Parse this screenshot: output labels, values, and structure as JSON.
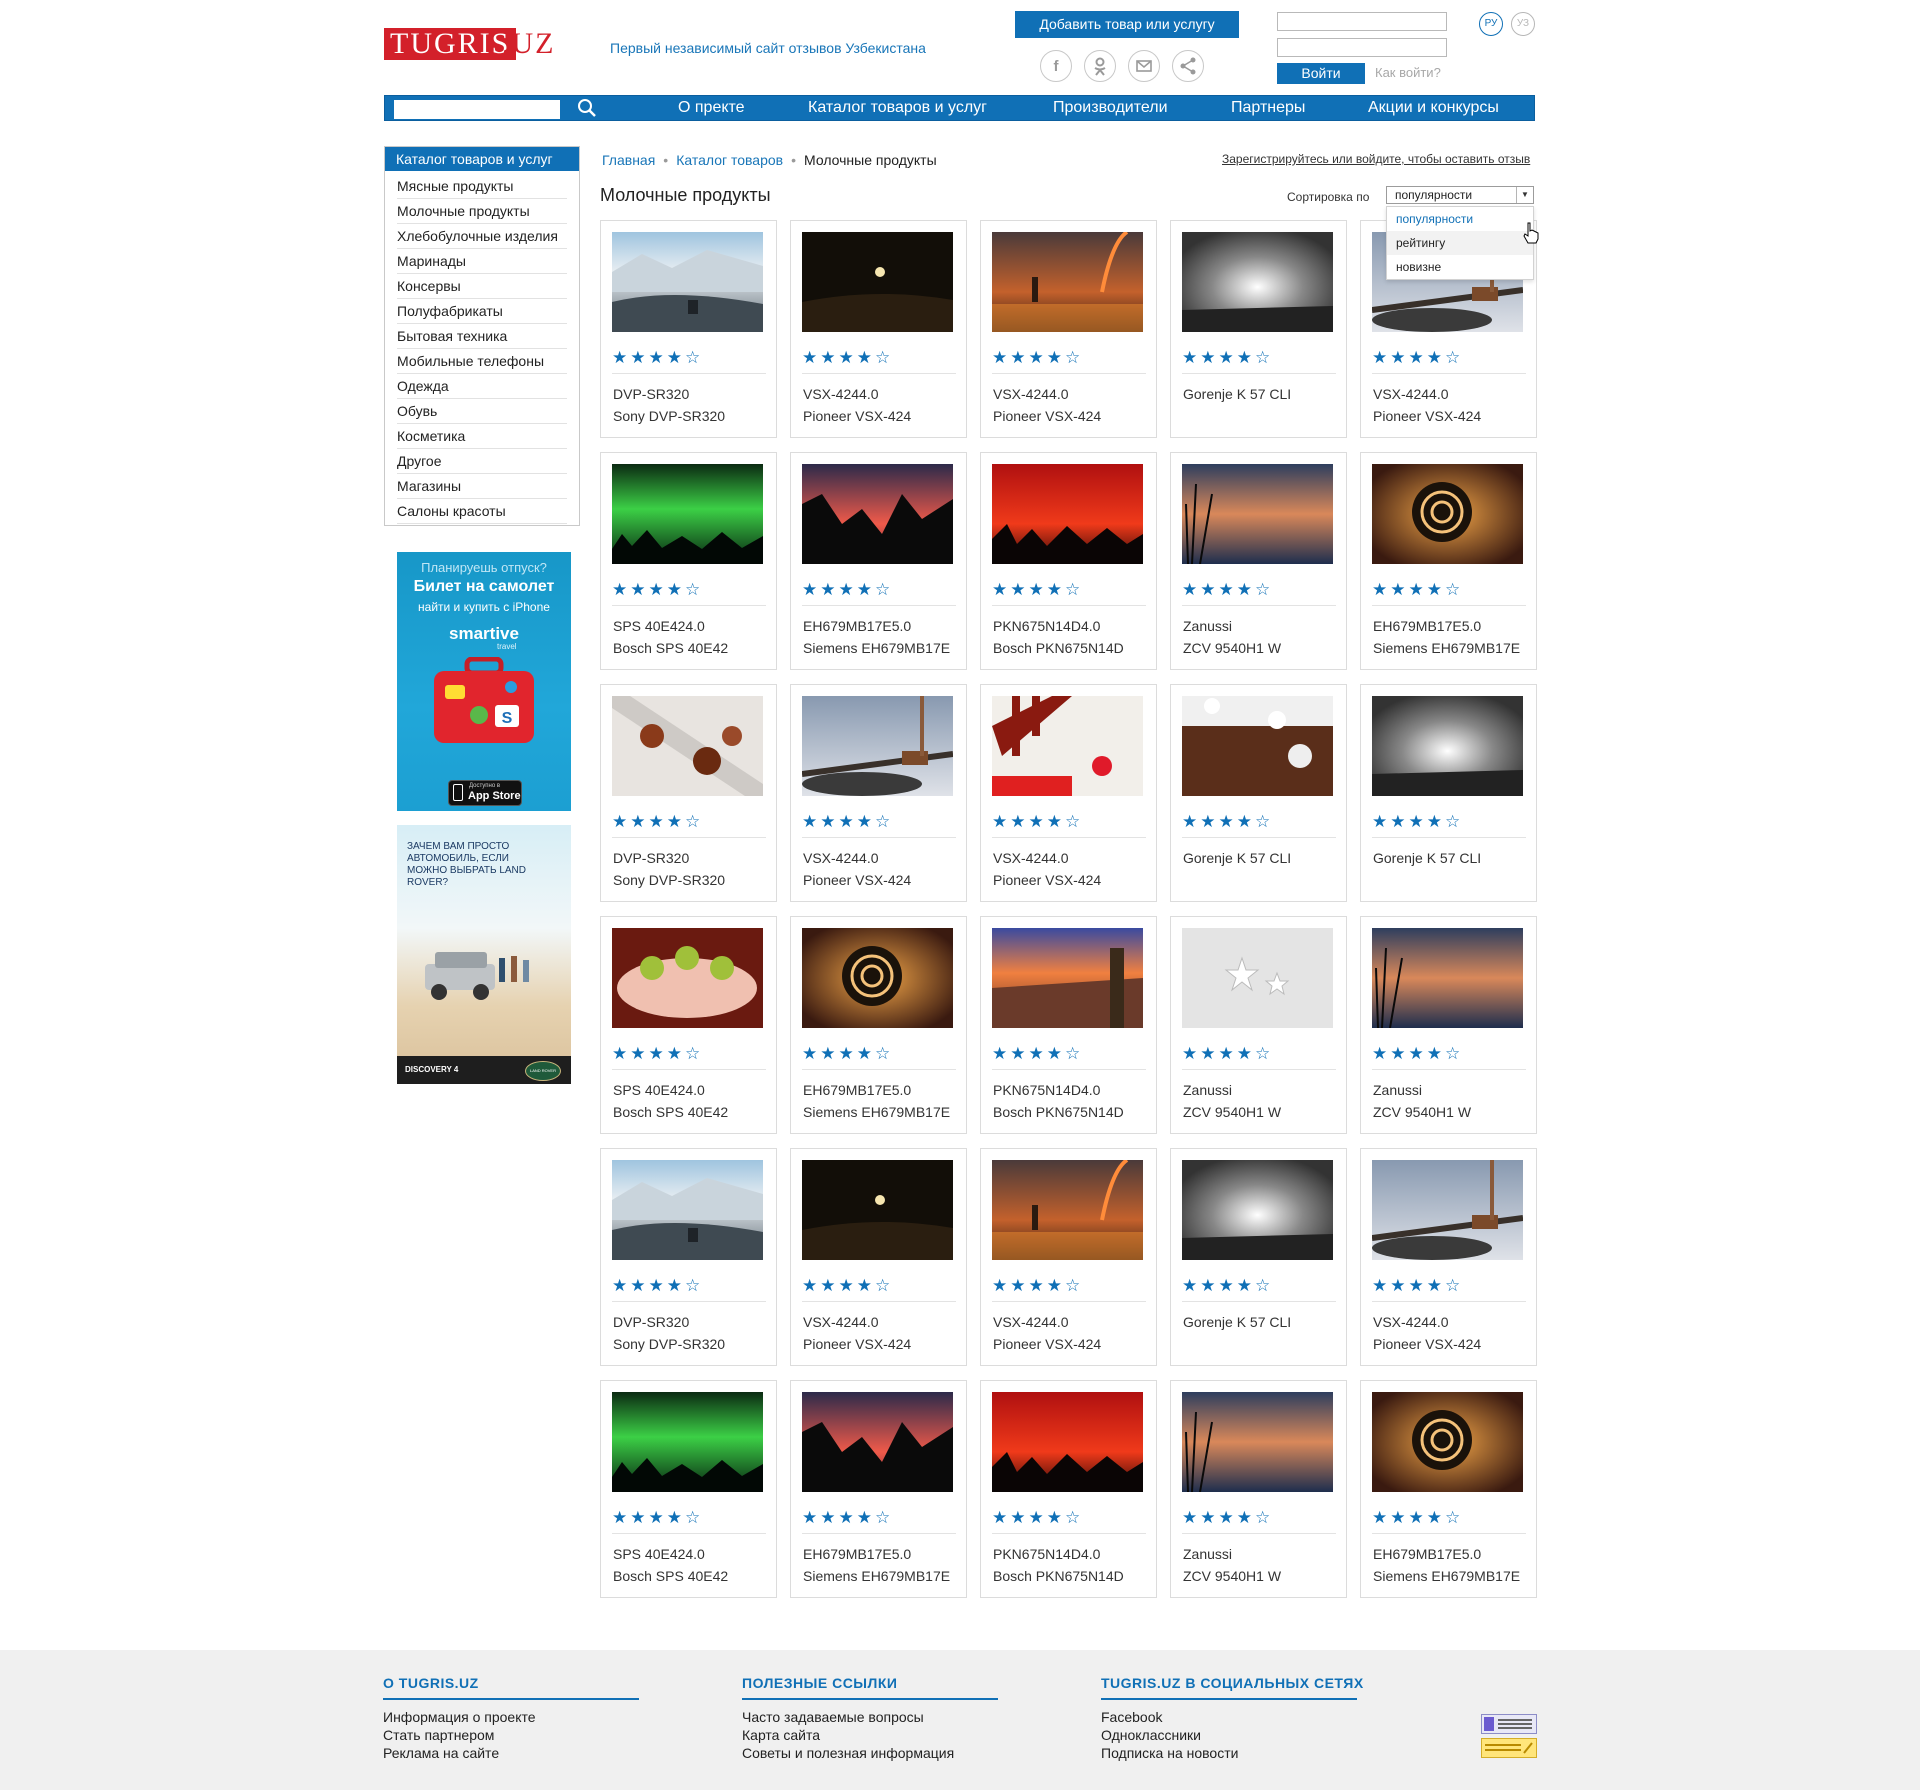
{
  "header": {
    "logo_left": "TUGRIS",
    "logo_right": ".UZ",
    "tagline": "Первый независимый сайт отзывов Узбекистана",
    "add_button": "Добавить товар или услугу",
    "login_button": "Войти",
    "how_to_login": "Как войти?",
    "lang_ru": "РУ",
    "lang_uz": "УЗ",
    "social_icons": [
      "facebook-icon",
      "odnoklassniki-icon",
      "mail-icon",
      "share-icon"
    ]
  },
  "nav": {
    "items": [
      "О пректе",
      "Каталог товаров и услуг",
      "Производители",
      "Партнеры",
      "Акции и конкурсы"
    ]
  },
  "sidebar": {
    "title": "Каталог товаров и услуг",
    "items": [
      "Мясные продукты",
      "Молочные продукты",
      "Хлебобулочные изделия",
      "Маринады",
      "Консервы",
      "Полуфабрикаты",
      "Бытовая техника",
      "Мобильные телефоны",
      "Одежда",
      "Обувь",
      "Косметика",
      "Другое",
      "Магазины",
      "Салоны красоты"
    ]
  },
  "ads": {
    "ad1": {
      "line1": "Планируешь отпуск?",
      "line2": "Билет на самолет",
      "line3": "найти и купить с iPhone",
      "brand": "smartive",
      "brand_sub": "travel",
      "store_small": "Доступно в",
      "store": "App Store"
    },
    "ad2": {
      "text": "ЗАЧЕМ ВАМ ПРОСТО АВТОМОБИЛЬ, ЕСЛИ МОЖНО ВЫБРАТЬ LAND ROVER?",
      "model": "DISCOVERY 4",
      "badge": "LAND ROVER"
    }
  },
  "breadcrumb": {
    "home": "Главная",
    "catalog": "Каталог товаров",
    "current": "Молочные продукты"
  },
  "register_link": "Зарегистрируйтесь или войдите, чтобы оставить отзыв",
  "page_title": "Молочные продукты",
  "sort": {
    "label": "Сортировка по",
    "selected": "популярности",
    "options": [
      "популярности",
      "рейтингу",
      "новизне"
    ],
    "accent": "#1070b6"
  },
  "rating_stars": "★★★★☆",
  "products": [
    {
      "line1": "DVP-SR320",
      "line2": "Sony DVP-SR320",
      "image": "mountain-snow"
    },
    {
      "line1": "VSX-4244.0",
      "line2": "Pioneer VSX-424",
      "image": "night-moon"
    },
    {
      "line1": "VSX-4244.0",
      "line2": "Pioneer VSX-424",
      "image": "harbor-rainbow"
    },
    {
      "line1": "Gorenje K 57 CLI",
      "line2": "",
      "image": "bw-sky"
    },
    {
      "line1": "VSX-4244.0",
      "line2": "Pioneer VSX-424",
      "image": "bamboo-stone"
    },
    {
      "line1": "SPS 40E424.0",
      "line2": "Bosch SPS 40E42",
      "image": "aurora"
    },
    {
      "line1": "EH679MB17E5.0",
      "line2": "Siemens EH679MB17E",
      "image": "trees-sunset"
    },
    {
      "line1": "PKN675N14D4.0",
      "line2": "Bosch PKN675N14D",
      "image": "red-sky"
    },
    {
      "line1": "Zanussi",
      "line2": "ZCV 9540H1 W",
      "image": "lake-reeds"
    },
    {
      "line1": "EH679MB17E5.0",
      "line2": "Siemens EH679MB17E",
      "image": "shell-sunset"
    },
    {
      "line1": "DVP-SR320",
      "line2": "Sony DVP-SR320",
      "image": "tea-cups"
    },
    {
      "line1": "VSX-4244.0",
      "line2": "Pioneer VSX-424",
      "image": "bamboo-stone"
    },
    {
      "line1": "VSX-4244.0",
      "line2": "Pioneer VSX-424",
      "image": "table-flower"
    },
    {
      "line1": "Gorenje K 57 CLI",
      "line2": "",
      "image": "spa-towel"
    },
    {
      "line1": "Gorenje K 57 CLI",
      "line2": "",
      "image": "bw-sky"
    },
    {
      "line1": "SPS 40E424.0",
      "line2": "Bosch SPS 40E42",
      "image": "orchid-hands"
    },
    {
      "line1": "EH679MB17E5.0",
      "line2": "Siemens EH679MB17E",
      "image": "shell-sunset"
    },
    {
      "line1": "PKN675N14D4.0",
      "line2": "Bosch PKN675N14D",
      "image": "canyon-tower"
    },
    {
      "line1": "Zanussi",
      "line2": "ZCV 9540H1 W",
      "image": "white-stars"
    },
    {
      "line1": "Zanussi",
      "line2": "ZCV 9540H1 W",
      "image": "lake-reeds"
    },
    {
      "line1": "DVP-SR320",
      "line2": "Sony DVP-SR320",
      "image": "mountain-snow"
    },
    {
      "line1": "VSX-4244.0",
      "line2": "Pioneer VSX-424",
      "image": "night-moon"
    },
    {
      "line1": "VSX-4244.0",
      "line2": "Pioneer VSX-424",
      "image": "harbor-rainbow"
    },
    {
      "line1": "Gorenje K 57 CLI",
      "line2": "",
      "image": "bw-sky"
    },
    {
      "line1": "VSX-4244.0",
      "line2": "Pioneer VSX-424",
      "image": "bamboo-stone"
    },
    {
      "line1": "SPS 40E424.0",
      "line2": "Bosch SPS 40E42",
      "image": "aurora"
    },
    {
      "line1": "EH679MB17E5.0",
      "line2": "Siemens EH679MB17E",
      "image": "trees-sunset"
    },
    {
      "line1": "PKN675N14D4.0",
      "line2": "Bosch PKN675N14D",
      "image": "red-sky"
    },
    {
      "line1": "Zanussi",
      "line2": "ZCV 9540H1 W",
      "image": "lake-reeds"
    },
    {
      "line1": "EH679MB17E5.0",
      "line2": "Siemens EH679MB17E",
      "image": "shell-sunset"
    }
  ],
  "footer": {
    "col1": {
      "title": "О TUGRIS.UZ",
      "links": [
        "Информация о проекте",
        "Стать партнером",
        "Реклама на сайте"
      ]
    },
    "col2": {
      "title": "ПОЛЕЗНЫЕ ССЫЛКИ",
      "links": [
        "Часто задаваемые вопросы",
        "Карта сайта",
        "Советы и полезная информация"
      ]
    },
    "col3": {
      "title": "TUGRIS.UZ В СОЦИАЛЬНЫХ СЕТЯХ",
      "links": [
        "Facebook",
        "Одноклассники",
        "Подписка на новости"
      ]
    }
  },
  "colors": {
    "brand_blue": "#1070b6",
    "logo_red": "#d3202a",
    "footer_bg": "#f0f0f0"
  }
}
